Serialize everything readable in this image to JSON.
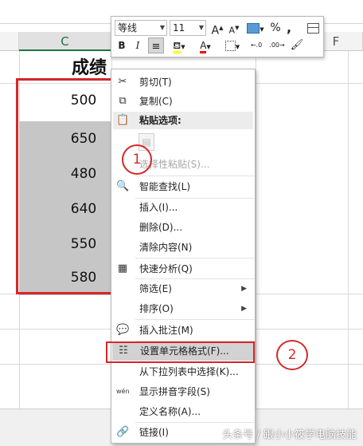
{
  "sheet": {
    "selected_column": "C",
    "right_column": "F",
    "header_text": "成绩",
    "values": [
      "500",
      "650",
      "480",
      "640",
      "550",
      "580"
    ]
  },
  "mini_toolbar": {
    "font_name": "等线",
    "font_size": "11",
    "grow_font": "A",
    "shrink_font": "A",
    "percent": "%",
    "comma": ",",
    "bold": "B",
    "italic": "I",
    "font_color": "A",
    "increase_decimal": "←.0",
    "decrease_decimal": ".00→",
    "fill_color_hex": "#ffff00",
    "font_color_hex": "#ff0000"
  },
  "context_menu": {
    "items": [
      {
        "label": "剪切(T)",
        "icon": "scissors-icon",
        "glyph": "✂"
      },
      {
        "label": "复制(C)",
        "icon": "copy-icon",
        "glyph": "⧉"
      },
      {
        "label": "粘贴选项:",
        "icon": "paste-icon",
        "glyph": "📋"
      },
      {
        "label": "选择性粘贴(S)...",
        "icon": "",
        "glyph": ""
      },
      {
        "label": "智能查找(L)",
        "icon": "smart-lookup-icon",
        "glyph": "🔍"
      },
      {
        "label": "插入(I)...",
        "icon": "",
        "glyph": ""
      },
      {
        "label": "删除(D)...",
        "icon": "",
        "glyph": ""
      },
      {
        "label": "清除内容(N)",
        "icon": "",
        "glyph": ""
      },
      {
        "label": "快速分析(Q)",
        "icon": "quick-analysis-icon",
        "glyph": "▦"
      },
      {
        "label": "筛选(E)",
        "icon": "",
        "glyph": ""
      },
      {
        "label": "排序(O)",
        "icon": "",
        "glyph": ""
      },
      {
        "label": "插入批注(M)",
        "icon": "comment-icon",
        "glyph": "💬"
      },
      {
        "label": "设置单元格格式(F)...",
        "icon": "format-cells-icon",
        "glyph": "☷"
      },
      {
        "label": "从下拉列表中选择(K)...",
        "icon": "",
        "glyph": ""
      },
      {
        "label": "显示拼音字段(S)",
        "icon": "pinyin-icon",
        "glyph": "wén"
      },
      {
        "label": "定义名称(A)...",
        "icon": "",
        "glyph": ""
      },
      {
        "label": "链接(I)",
        "icon": "link-icon",
        "glyph": "🔗"
      }
    ],
    "submenu_arrow": "▶"
  },
  "annotations": {
    "step1": "1",
    "step2": "2",
    "color": "#d42828"
  },
  "watermark": "头条号 / 跟小小筱学电脑技能"
}
